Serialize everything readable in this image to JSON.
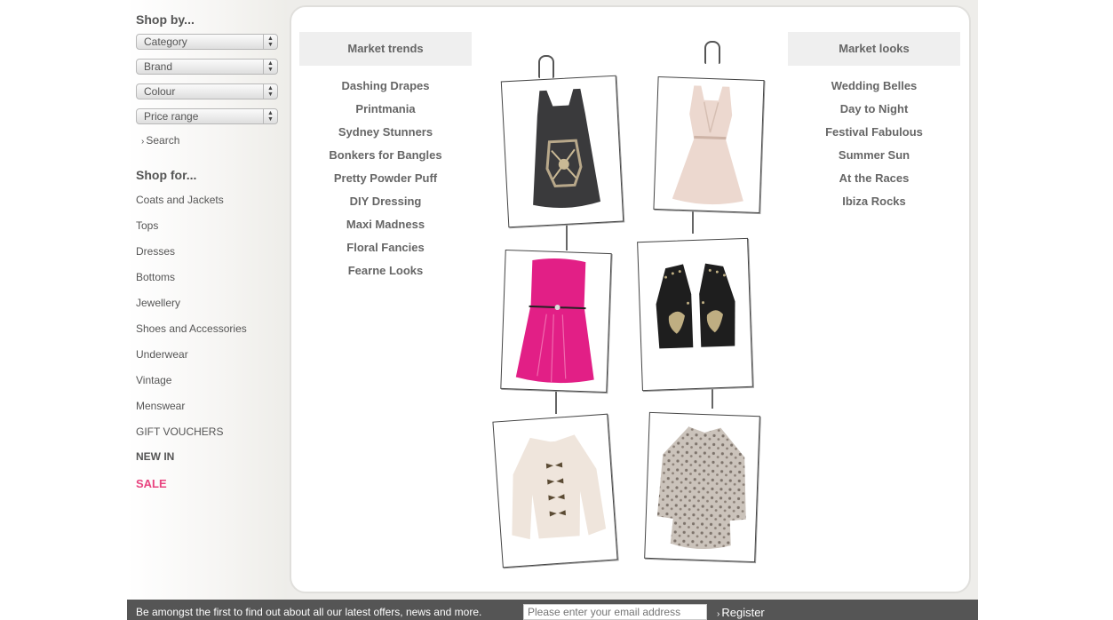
{
  "sidebar": {
    "shop_by_heading": "Shop by...",
    "selects": [
      "Category",
      "Brand",
      "Colour",
      "Price range"
    ],
    "search_label": "Search",
    "shop_for_heading": "Shop for...",
    "categories": [
      "Coats and Jackets",
      "Tops",
      "Dresses",
      "Bottoms",
      "Jewellery",
      "Shoes and Accessories",
      "Underwear",
      "Vintage",
      "Menswear",
      "GIFT VOUCHERS"
    ],
    "new_in": "NEW IN",
    "sale": "SALE"
  },
  "market_trends": {
    "heading": "Market trends",
    "links": [
      "Dashing Drapes",
      "Printmania",
      "Sydney Stunners",
      "Bonkers for Bangles",
      "Pretty Powder Puff",
      "DIY Dressing",
      "Maxi Madness",
      "Floral Fancies",
      "Fearne Looks"
    ]
  },
  "market_looks": {
    "heading": "Market looks",
    "links": [
      "Wedding Belles",
      "Day to Night",
      "Festival Fabulous",
      "Summer Sun",
      "At the Races",
      "Ibiza Rocks"
    ]
  },
  "footer": {
    "text": "Be amongst the first to find out about all our latest offers, news and more.",
    "email_placeholder": "Please enter your email address",
    "register_label": "Register"
  },
  "colors": {
    "sale": "#e8437f",
    "footer_bg": "#555555"
  }
}
